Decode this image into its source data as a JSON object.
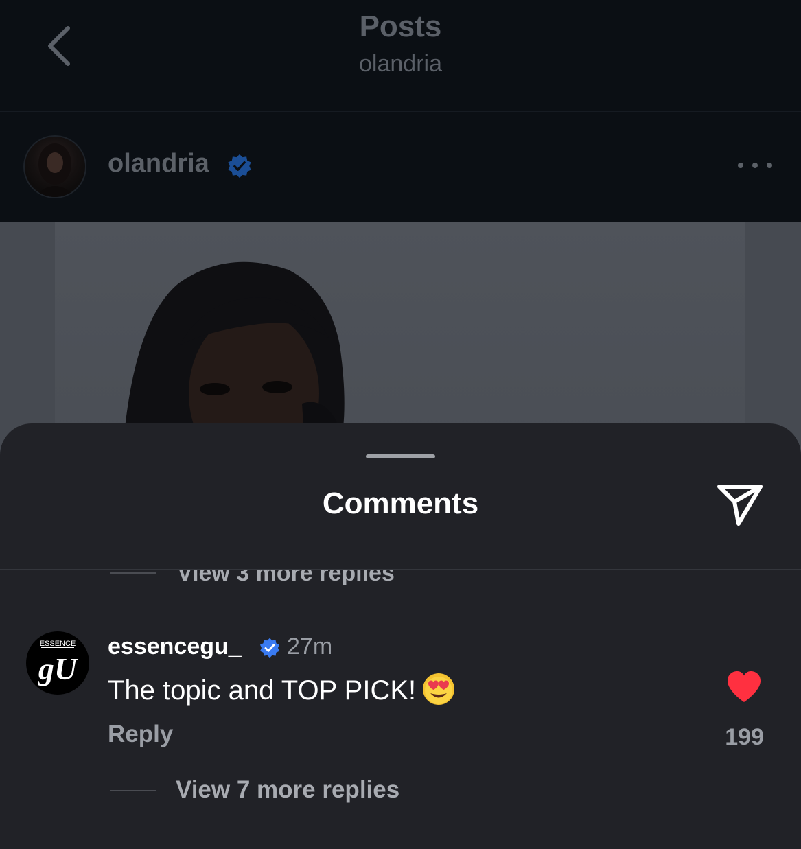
{
  "header": {
    "title": "Posts",
    "subtitle": "olandria"
  },
  "post": {
    "author": "olandria",
    "author_verified": true
  },
  "comments_sheet": {
    "title": "Comments",
    "clipped_replies_label": "View 3 more replies",
    "comment": {
      "username": "essencegu_",
      "verified": true,
      "time": "27m",
      "text": "The topic and TOP PICK!",
      "emoji": "heart-eyes-emoji",
      "reply_label": "Reply",
      "likes": "199",
      "liked": true,
      "avatar_text_top": "ESSENCE",
      "avatar_text_main": "gU",
      "view_more_label": "View 7 more replies"
    }
  },
  "colors": {
    "sheet_bg": "#212227",
    "verified_blue": "#3a7bf2",
    "like_red": "#ff3040"
  }
}
